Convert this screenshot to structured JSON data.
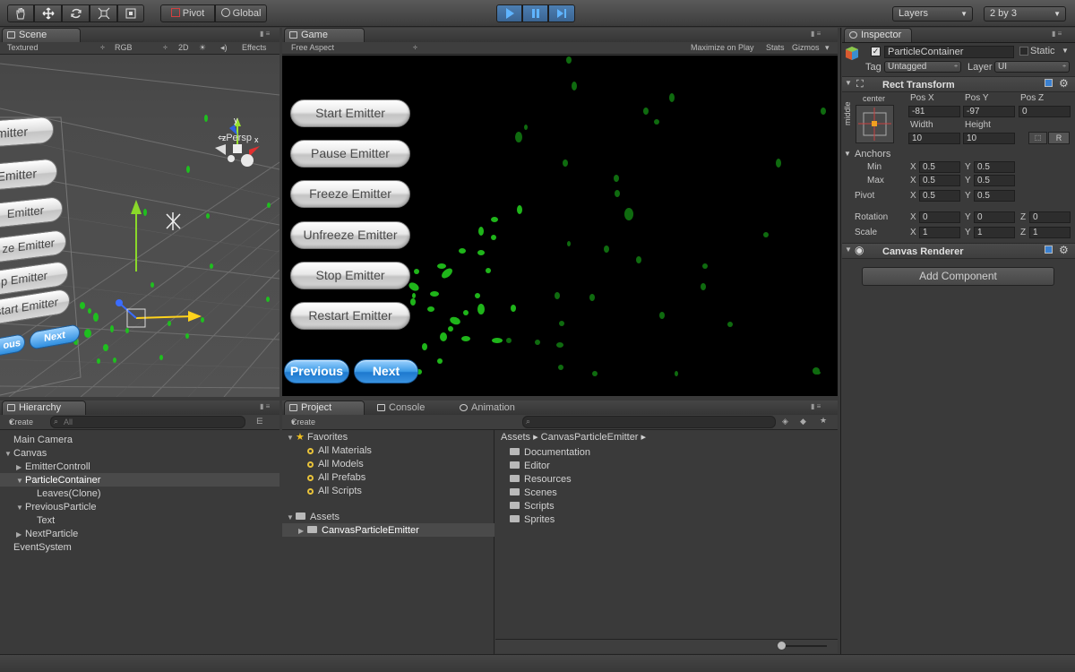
{
  "toolbar": {
    "pivot": "Pivot",
    "global": "Global",
    "layers": "Layers",
    "layout": "2 by 3"
  },
  "scene": {
    "tab": "Scene",
    "shading": "Textured",
    "render": "RGB",
    "mode2d": "2D",
    "effects": "Effects",
    "persp": "Persp",
    "buttons": [
      "mitter",
      "Emitter",
      "Emitter",
      "ze Emitter",
      "p Emitter",
      "start Emitter"
    ],
    "prev": "ous",
    "next": "Next"
  },
  "game": {
    "tab": "Game",
    "aspect": "Free Aspect",
    "maximize": "Maximize on Play",
    "stats": "Stats",
    "gizmos": "Gizmos",
    "buttons": [
      "Start Emitter",
      "Pause Emitter",
      "Freeze Emitter",
      "Unfreeze Emitter",
      "Stop Emitter",
      "Restart Emitter"
    ],
    "previous": "Previous",
    "next": "Next"
  },
  "hierarchy": {
    "tab": "Hierarchy",
    "create": "Create",
    "search": "All",
    "items": [
      "Main Camera",
      "Canvas",
      "EmitterControll",
      "ParticleContainer",
      "Leaves(Clone)",
      "PreviousParticle",
      "Text",
      "NextParticle",
      "EventSystem"
    ]
  },
  "project": {
    "tabs": [
      "Project",
      "Console",
      "Animation"
    ],
    "create": "Create",
    "favorites": "Favorites",
    "fav_items": [
      "All Materials",
      "All Models",
      "All Prefabs",
      "All Scripts"
    ],
    "assets": "Assets",
    "asset_child": "CanvasParticleEmitter",
    "breadcrumb": [
      "Assets",
      "CanvasParticleEmitter"
    ],
    "folders": [
      "Documentation",
      "Editor",
      "Resources",
      "Scenes",
      "Scripts",
      "Sprites"
    ]
  },
  "inspector": {
    "tab": "Inspector",
    "object": "ParticleContainer",
    "static": "Static",
    "tag_label": "Tag",
    "tag": "Untagged",
    "layer_label": "Layer",
    "layer": "UI",
    "rect_transform": "Rect Transform",
    "anchor_h": "center",
    "anchor_v": "middle",
    "posx_label": "Pos X",
    "posy_label": "Pos Y",
    "posz_label": "Pos Z",
    "posx": "-81",
    "posy": "-97",
    "posz": "0",
    "width_label": "Width",
    "height_label": "Height",
    "width": "10",
    "height": "10",
    "anchors": "Anchors",
    "min": "Min",
    "max": "Max",
    "pivot": "Pivot",
    "min_x": "0.5",
    "min_y": "0.5",
    "max_x": "0.5",
    "max_y": "0.5",
    "pivot_x": "0.5",
    "pivot_y": "0.5",
    "rotation": "Rotation",
    "rot_x": "0",
    "rot_y": "0",
    "rot_z": "0",
    "scale": "Scale",
    "scale_x": "1",
    "scale_y": "1",
    "scale_z": "1",
    "x": "X",
    "y": "Y",
    "z": "Z",
    "r": "R",
    "canvas_renderer": "Canvas Renderer",
    "add_component": "Add Component"
  },
  "colors": {
    "leaf": "#22b01c",
    "blue_button": "#2f8fe0",
    "panel": "#3a3a3a"
  }
}
